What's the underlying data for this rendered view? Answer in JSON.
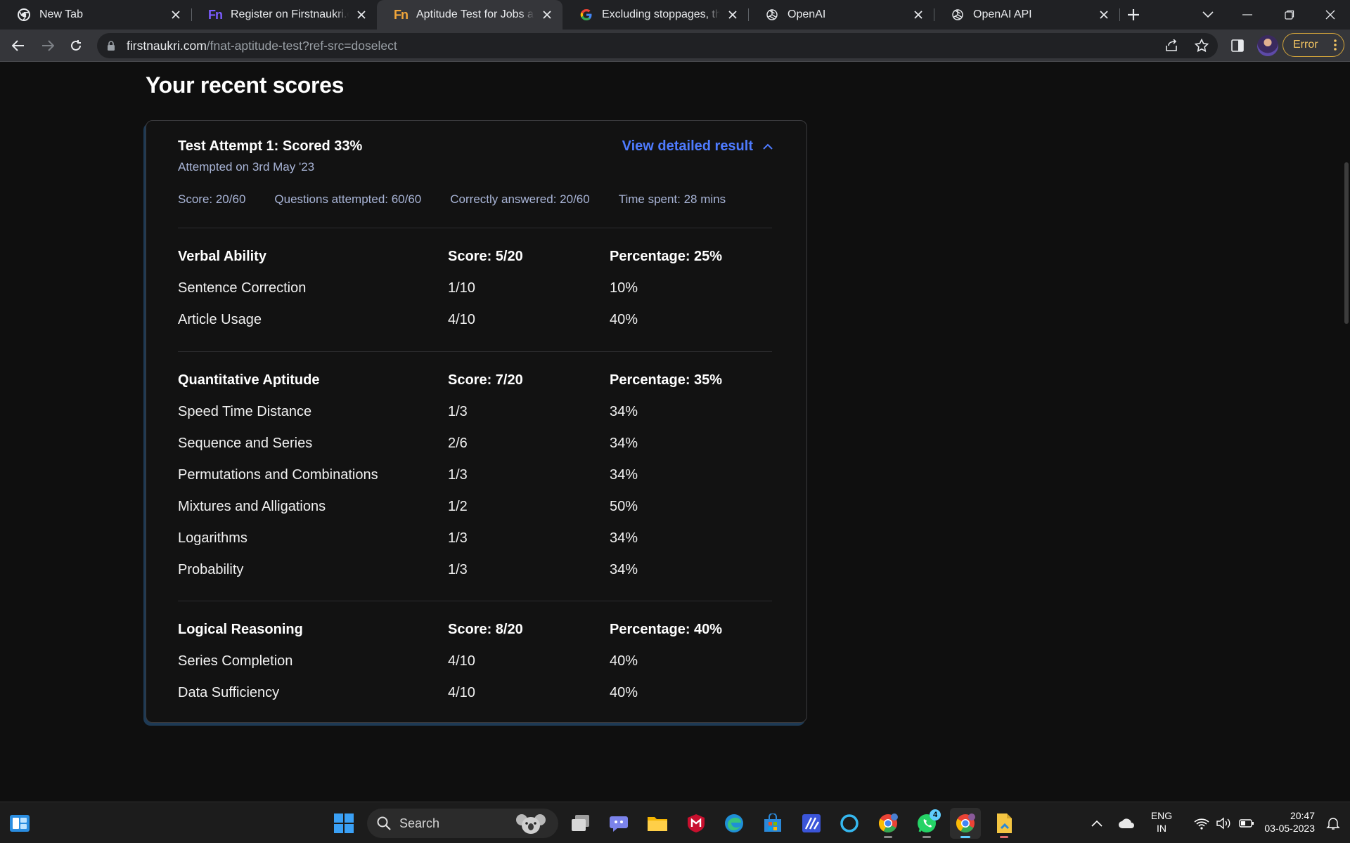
{
  "browser": {
    "tabs": [
      {
        "title": "New Tab",
        "icon": "chrome-icon"
      },
      {
        "title": "Register on Firstnaukri.com",
        "icon": "firstnaukri-logo-icon"
      },
      {
        "title": "Aptitude Test for Jobs and I",
        "icon": "firstnaukri-logo-icon",
        "active": true
      },
      {
        "title": "Excluding stoppages, the av",
        "icon": "google-icon"
      },
      {
        "title": "OpenAI",
        "icon": "openai-icon"
      },
      {
        "title": "OpenAI API",
        "icon": "openai-icon"
      }
    ],
    "fn_logo_text": "Fn",
    "url_host": "firstnaukri.com",
    "url_path": "/fnat-aptitude-test?ref-src=doselect",
    "error_label": "Error"
  },
  "page": {
    "title": "Your recent scores",
    "attempt": {
      "title": "Test Attempt 1: Scored 33%",
      "date": "Attempted on 3rd May '23",
      "detail_link": "View detailed result",
      "stats": {
        "score": "Score: 20/60",
        "attempted": "Questions attempted: 60/60",
        "correct": "Correctly answered: 20/60",
        "time": "Time spent: 28 mins"
      }
    },
    "sections": [
      {
        "name": "Verbal Ability",
        "score": "Score: 5/20",
        "percentage": "Percentage: 25%",
        "topics": [
          {
            "name": "Sentence Correction",
            "score": "1/10",
            "percentage": "10%"
          },
          {
            "name": "Article Usage",
            "score": "4/10",
            "percentage": "40%"
          }
        ]
      },
      {
        "name": "Quantitative Aptitude",
        "score": "Score: 7/20",
        "percentage": "Percentage: 35%",
        "topics": [
          {
            "name": "Speed Time Distance",
            "score": "1/3",
            "percentage": "34%"
          },
          {
            "name": "Sequence and Series",
            "score": "2/6",
            "percentage": "34%"
          },
          {
            "name": "Permutations and Combinations",
            "score": "1/3",
            "percentage": "34%"
          },
          {
            "name": "Mixtures and Alligations",
            "score": "1/2",
            "percentage": "50%"
          },
          {
            "name": "Logarithms",
            "score": "1/3",
            "percentage": "34%"
          },
          {
            "name": "Probability",
            "score": "1/3",
            "percentage": "34%"
          }
        ]
      },
      {
        "name": "Logical Reasoning",
        "score": "Score: 8/20",
        "percentage": "Percentage: 40%",
        "topics": [
          {
            "name": "Series Completion",
            "score": "4/10",
            "percentage": "40%"
          },
          {
            "name": "Data Sufficiency",
            "score": "4/10",
            "percentage": "40%"
          }
        ]
      }
    ]
  },
  "taskbar": {
    "search_label": "Search",
    "whatsapp_badge": "4",
    "lang_line1": "ENG",
    "lang_line2": "IN",
    "time": "20:47",
    "date": "03-05-2023"
  },
  "colors": {
    "accent_link": "#4e7bff",
    "muted_text": "#a8b4d6",
    "error_pill": "#d4a53a"
  }
}
